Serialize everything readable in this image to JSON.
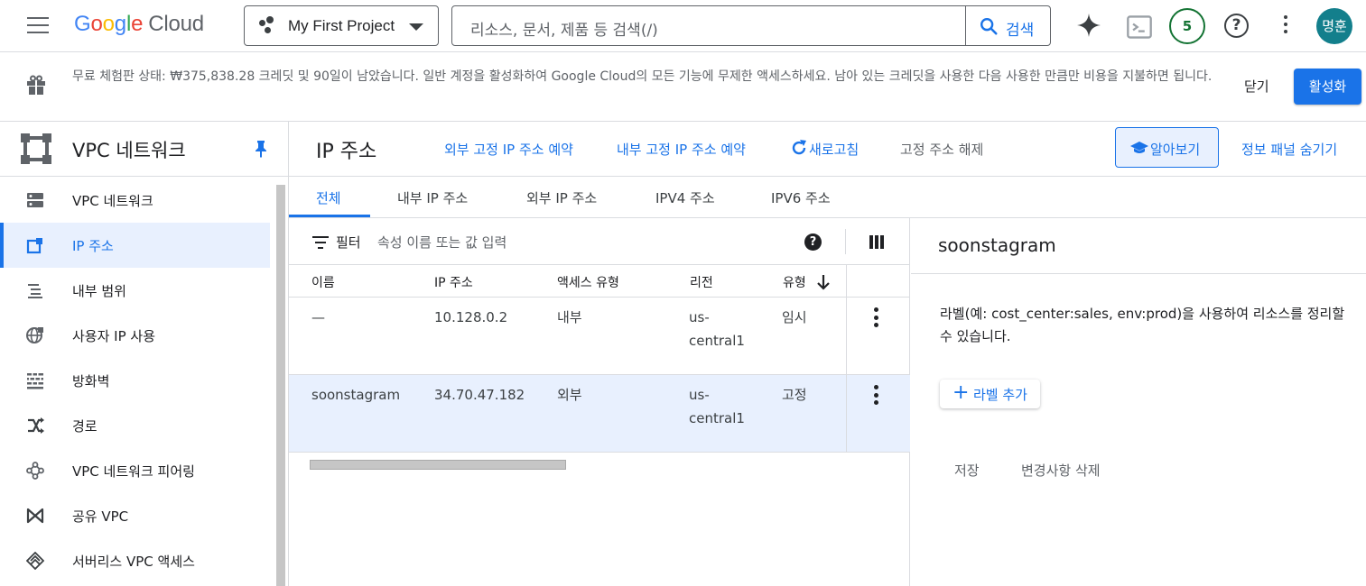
{
  "topbar": {
    "logo_google": "Google",
    "logo_cloud": "Cloud",
    "project_name": "My First Project",
    "search_placeholder": "리소스, 문서, 제품 등 검색(/)",
    "search_button": "검색",
    "notification_count": "5",
    "help_glyph": "?",
    "avatar_text": "명훈",
    "icons": [
      "menu-icon",
      "project-dots-icon",
      "search-icon",
      "gemini-spark-icon",
      "cloud-shell-icon",
      "help-icon",
      "more-vert-icon"
    ]
  },
  "banner": {
    "text": "무료 체험판 상태: ₩375,838.28 크레딧 및 90일이 남았습니다. 일반 계정을 활성화하여 Google Cloud의 모든 기능에 무제한 액세스하세요. 남아 있는 크레딧을 사용한 다음 사용한 만큼만 비용을 지불하면 됩니다.",
    "close_label": "닫기",
    "activate_label": "활성화"
  },
  "sidebar": {
    "title": "VPC 네트워크",
    "items": [
      {
        "label": "VPC 네트워크",
        "icon": "vpc-network-icon",
        "active": false
      },
      {
        "label": "IP 주소",
        "icon": "ip-address-icon",
        "active": true
      },
      {
        "label": "내부 범위",
        "icon": "internal-range-icon",
        "active": false
      },
      {
        "label": "사용자 IP 사용",
        "icon": "byoip-globe-icon",
        "active": false
      },
      {
        "label": "방화벽",
        "icon": "firewall-icon",
        "active": false
      },
      {
        "label": "경로",
        "icon": "routes-icon",
        "active": false
      },
      {
        "label": "VPC 네트워크 피어링",
        "icon": "peering-icon",
        "active": false
      },
      {
        "label": "공유 VPC",
        "icon": "shared-vpc-icon",
        "active": false
      },
      {
        "label": "서버리스 VPC 액세스",
        "icon": "serverless-vpc-icon",
        "active": false
      }
    ]
  },
  "page": {
    "title": "IP 주소",
    "reserve_external": "외부 고정 IP 주소 예약",
    "reserve_internal": "내부 고정 IP 주소 예약",
    "refresh": "새로고침",
    "release_static": "고정 주소 해제",
    "learn": "알아보기",
    "hide_info_panel": "정보 패널 숨기기"
  },
  "tabs": [
    "전체",
    "내부 IP 주소",
    "외부 IP 주소",
    "IPV4 주소",
    "IPV6 주소"
  ],
  "filter": {
    "label": "필터",
    "placeholder": "속성 이름 또는 값 입력",
    "help_glyph": "?"
  },
  "table": {
    "columns": [
      "이름",
      "IP 주소",
      "액세스 유형",
      "리전",
      "유형"
    ],
    "rows": [
      {
        "name": "—",
        "ip": "10.128.0.2",
        "access": "내부",
        "region": "us-central1",
        "type": "임시",
        "selected": false
      },
      {
        "name": "soonstagram",
        "ip": "34.70.47.182",
        "access": "외부",
        "region": "us-central1",
        "type": "고정",
        "selected": true
      }
    ]
  },
  "info_panel": {
    "title": "soonstagram",
    "description": "라벨(예: cost_center:sales, env:prod)을 사용하여 리소스를 정리할 수 있습니다.",
    "add_label": "라벨 추가",
    "save": "저장",
    "discard": "변경사항 삭제"
  },
  "colors": {
    "accent": "#1a73e8",
    "selected_bg": "#e8f0fe",
    "text_primary": "#202124",
    "text_secondary": "#5f6368",
    "notification_green": "#137333",
    "avatar_teal": "#137f8c"
  }
}
